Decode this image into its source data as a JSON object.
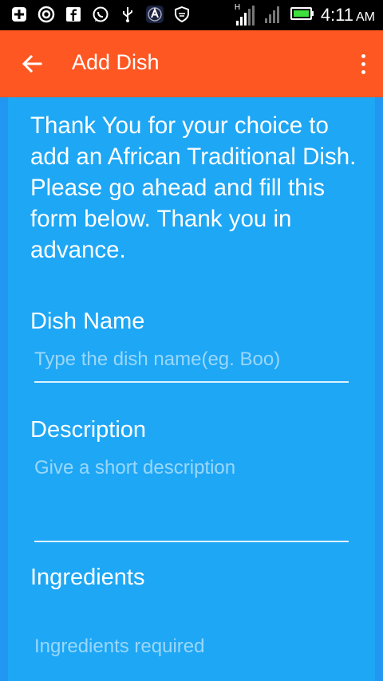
{
  "status_bar": {
    "time": "4:11",
    "ampm": "AM",
    "signal_label": "H"
  },
  "app_bar": {
    "title": "Add Dish",
    "back_icon": "arrow-back-icon",
    "overflow_icon": "more-vert-icon"
  },
  "form": {
    "intro": "Thank You for your choice to add an African Traditional Dish. Please go ahead and fill this form below. Thank you in advance.",
    "dish_name": {
      "label": "Dish Name",
      "placeholder": "Type the dish name(eg. Boo)"
    },
    "description": {
      "label": "Description",
      "placeholder": "Give a short description"
    },
    "ingredients": {
      "label": "Ingredients",
      "placeholder": "Ingredients required"
    }
  },
  "colors": {
    "app_bar": "#ff5722",
    "background": "#2196f3",
    "form": "#1ea7f5"
  }
}
